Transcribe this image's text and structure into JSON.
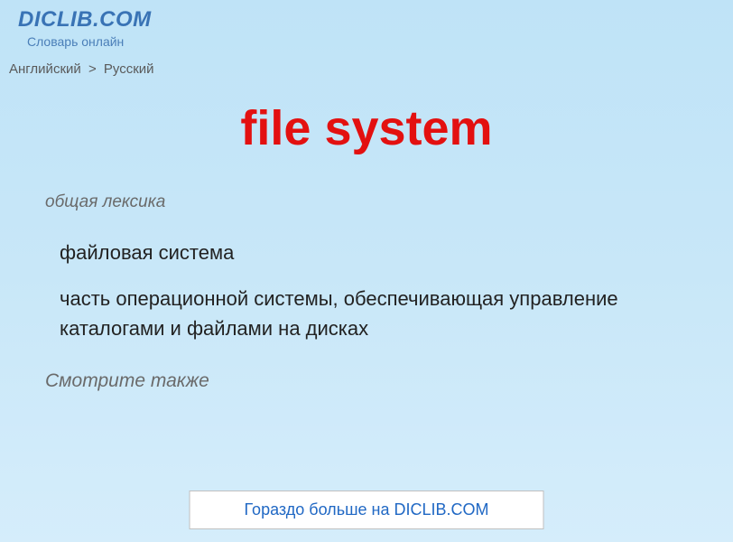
{
  "header": {
    "site_title": "DICLIB.COM",
    "site_subtitle": "Словарь онлайн"
  },
  "breadcrumb": {
    "from": "Английский",
    "separator": ">",
    "to": "Русский"
  },
  "entry": {
    "term": "file system",
    "category": "общая лексика",
    "definitions": [
      "файловая система",
      "часть операционной системы, обеспечивающая управление каталогами и файлами на дисках"
    ],
    "see_also_label": "Смотрите также"
  },
  "footer": {
    "more_link": "Гораздо больше на DICLIB.COM"
  }
}
